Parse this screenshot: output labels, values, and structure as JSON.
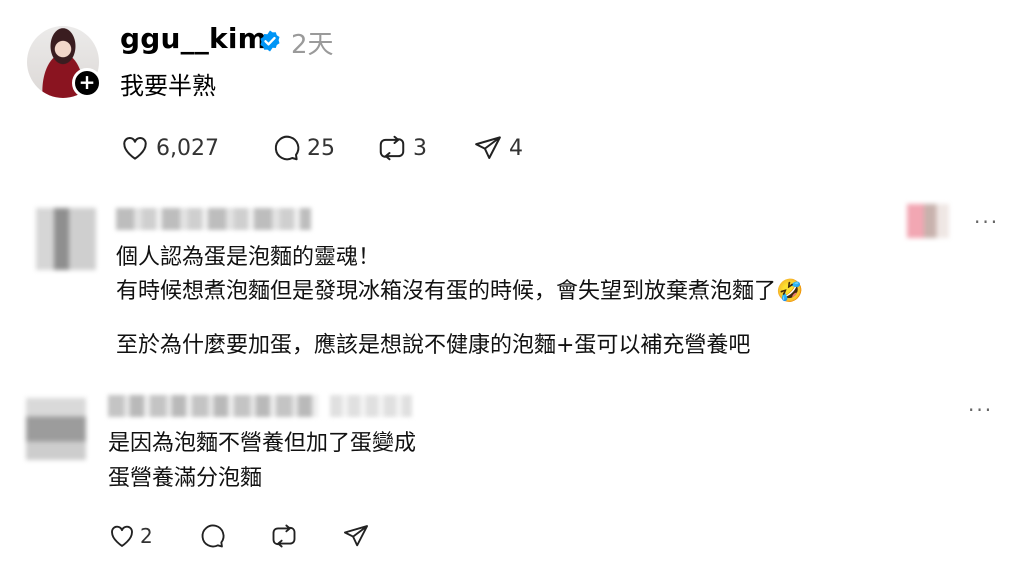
{
  "post": {
    "username": "ggu__kim",
    "time_ago": "2天",
    "text": "我要半熟",
    "stats": {
      "likes": "6,027",
      "comments": "25",
      "reposts": "3",
      "shares": "4"
    }
  },
  "comments": [
    {
      "lines": [
        "個人認為蛋是泡麵的靈魂！",
        "有時候想煮泡麵但是發現冰箱沒有蛋的時候，會失望到放棄煮泡麵了🤣",
        "至於為什麼要加蛋，應該是想說不健康的泡麵+蛋可以補充營養吧"
      ],
      "more": "···"
    },
    {
      "lines": [
        "是因為泡麵不營養但加了蛋變成",
        "蛋營養滿分泡麵"
      ],
      "more": "···",
      "likes": "2"
    }
  ],
  "colors": {
    "verified_blue": "#0095f6",
    "muted": "#9a9a9a"
  }
}
